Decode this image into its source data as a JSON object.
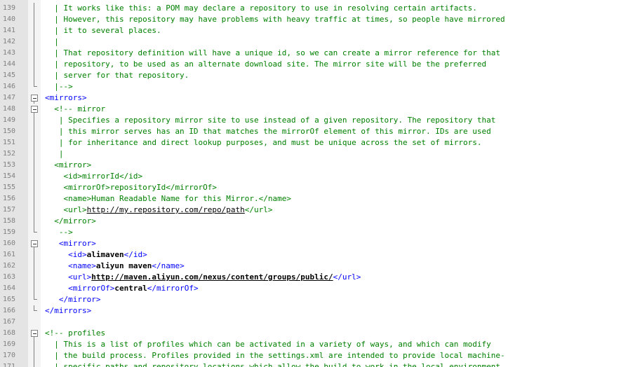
{
  "lines": [
    {
      "num": "139",
      "indent": "  ",
      "fold": "vline",
      "segments": [
        {
          "cls": "c",
          "text": "| It works like this: a POM may declare a repository to use in resolving certain artifacts."
        }
      ]
    },
    {
      "num": "140",
      "indent": "  ",
      "fold": "vline",
      "segments": [
        {
          "cls": "c",
          "text": "| However, this repository may have problems with heavy traffic at times, so people have mirrored"
        }
      ]
    },
    {
      "num": "141",
      "indent": "  ",
      "fold": "vline",
      "segments": [
        {
          "cls": "c",
          "text": "| it to several places."
        }
      ]
    },
    {
      "num": "142",
      "indent": "  ",
      "fold": "vline",
      "segments": [
        {
          "cls": "c",
          "text": "|"
        }
      ]
    },
    {
      "num": "143",
      "indent": "  ",
      "fold": "vline",
      "segments": [
        {
          "cls": "c",
          "text": "| That repository definition will have a unique id, so we can create a mirror reference for that"
        }
      ]
    },
    {
      "num": "144",
      "indent": "  ",
      "fold": "vline",
      "segments": [
        {
          "cls": "c",
          "text": "| repository, to be used as an alternate download site. The mirror site will be the preferred"
        }
      ]
    },
    {
      "num": "145",
      "indent": "  ",
      "fold": "vline",
      "segments": [
        {
          "cls": "c",
          "text": "| server for that repository."
        }
      ]
    },
    {
      "num": "146",
      "indent": "  ",
      "fold": "corner",
      "segments": [
        {
          "cls": "c",
          "text": "|-->"
        }
      ]
    },
    {
      "num": "147",
      "indent": "",
      "fold": "box",
      "segments": [
        {
          "cls": "t",
          "text": "<mirrors>"
        }
      ]
    },
    {
      "num": "148",
      "indent": "  ",
      "fold": "box",
      "segments": [
        {
          "cls": "c",
          "text": "<!-- mirror"
        }
      ]
    },
    {
      "num": "149",
      "indent": "   ",
      "fold": "vline",
      "segments": [
        {
          "cls": "c",
          "text": "| Specifies a repository mirror site to use instead of a given repository. The repository that"
        }
      ]
    },
    {
      "num": "150",
      "indent": "   ",
      "fold": "vline",
      "segments": [
        {
          "cls": "c",
          "text": "| this mirror serves has an ID that matches the mirrorOf element of this mirror. IDs are used"
        }
      ]
    },
    {
      "num": "151",
      "indent": "   ",
      "fold": "vline",
      "segments": [
        {
          "cls": "c",
          "text": "| for inheritance and direct lookup purposes, and must be unique across the set of mirrors."
        }
      ]
    },
    {
      "num": "152",
      "indent": "   ",
      "fold": "vline",
      "segments": [
        {
          "cls": "c",
          "text": "|"
        }
      ]
    },
    {
      "num": "153",
      "indent": "  ",
      "fold": "vline",
      "segments": [
        {
          "cls": "c",
          "text": "<mirror>"
        }
      ]
    },
    {
      "num": "154",
      "indent": "    ",
      "fold": "vline",
      "segments": [
        {
          "cls": "c",
          "text": "<id>mirrorId</id>"
        }
      ]
    },
    {
      "num": "155",
      "indent": "    ",
      "fold": "vline",
      "segments": [
        {
          "cls": "c",
          "text": "<mirrorOf>repositoryId</mirrorOf>"
        }
      ]
    },
    {
      "num": "156",
      "indent": "    ",
      "fold": "vline",
      "segments": [
        {
          "cls": "c",
          "text": "<name>Human Readable Name for this Mirror.</name>"
        }
      ]
    },
    {
      "num": "157",
      "indent": "    ",
      "fold": "vline",
      "segments": [
        {
          "cls": "c",
          "text": "<url>"
        },
        {
          "cls": "u",
          "text": "http://my.repository.com/repo/path"
        },
        {
          "cls": "c",
          "text": "</url>"
        }
      ]
    },
    {
      "num": "158",
      "indent": "  ",
      "fold": "vline",
      "segments": [
        {
          "cls": "c",
          "text": "</mirror>"
        }
      ]
    },
    {
      "num": "159",
      "indent": "   ",
      "fold": "corner",
      "segments": [
        {
          "cls": "c",
          "text": "-->"
        }
      ]
    },
    {
      "num": "160",
      "indent": "   ",
      "fold": "box",
      "segments": [
        {
          "cls": "t",
          "text": "<mirror>"
        }
      ]
    },
    {
      "num": "161",
      "indent": "     ",
      "fold": "vline",
      "segments": [
        {
          "cls": "t",
          "text": "<id>"
        },
        {
          "cls": "b",
          "text": "alimaven"
        },
        {
          "cls": "t",
          "text": "</id>"
        }
      ]
    },
    {
      "num": "162",
      "indent": "     ",
      "fold": "vline",
      "segments": [
        {
          "cls": "t",
          "text": "<name>"
        },
        {
          "cls": "b",
          "text": "aliyun maven"
        },
        {
          "cls": "t",
          "text": "</name>"
        }
      ]
    },
    {
      "num": "163",
      "indent": "     ",
      "fold": "vline",
      "segments": [
        {
          "cls": "t",
          "text": "<url>"
        },
        {
          "cls": "ub",
          "text": "http://maven.aliyun.com/nexus/content/groups/public/"
        },
        {
          "cls": "t",
          "text": "</url>"
        }
      ]
    },
    {
      "num": "164",
      "indent": "     ",
      "fold": "vline",
      "segments": [
        {
          "cls": "t",
          "text": "<mirrorOf>"
        },
        {
          "cls": "b",
          "text": "central"
        },
        {
          "cls": "t",
          "text": "</mirrorOf>"
        }
      ]
    },
    {
      "num": "165",
      "indent": "   ",
      "fold": "corner",
      "segments": [
        {
          "cls": "t",
          "text": "</mirror>"
        }
      ]
    },
    {
      "num": "166",
      "indent": "",
      "fold": "corner",
      "segments": [
        {
          "cls": "t",
          "text": "</mirrors>"
        }
      ]
    },
    {
      "num": "167",
      "indent": "",
      "fold": "none",
      "segments": []
    },
    {
      "num": "168",
      "indent": "",
      "fold": "box",
      "segments": [
        {
          "cls": "c",
          "text": "<!-- profiles"
        }
      ]
    },
    {
      "num": "169",
      "indent": "  ",
      "fold": "vline",
      "segments": [
        {
          "cls": "c",
          "text": "| This is a list of profiles which can be activated in a variety of ways, and which can modify"
        }
      ]
    },
    {
      "num": "170",
      "indent": "  ",
      "fold": "vline",
      "segments": [
        {
          "cls": "c",
          "text": "| the build process. Profiles provided in the settings.xml are intended to provide local machine-"
        }
      ]
    },
    {
      "num": "171",
      "indent": "  ",
      "fold": "vline",
      "segments": [
        {
          "cls": "c",
          "text": "| specific paths and repository locations which allow the build to work in the local environment."
        }
      ]
    }
  ]
}
